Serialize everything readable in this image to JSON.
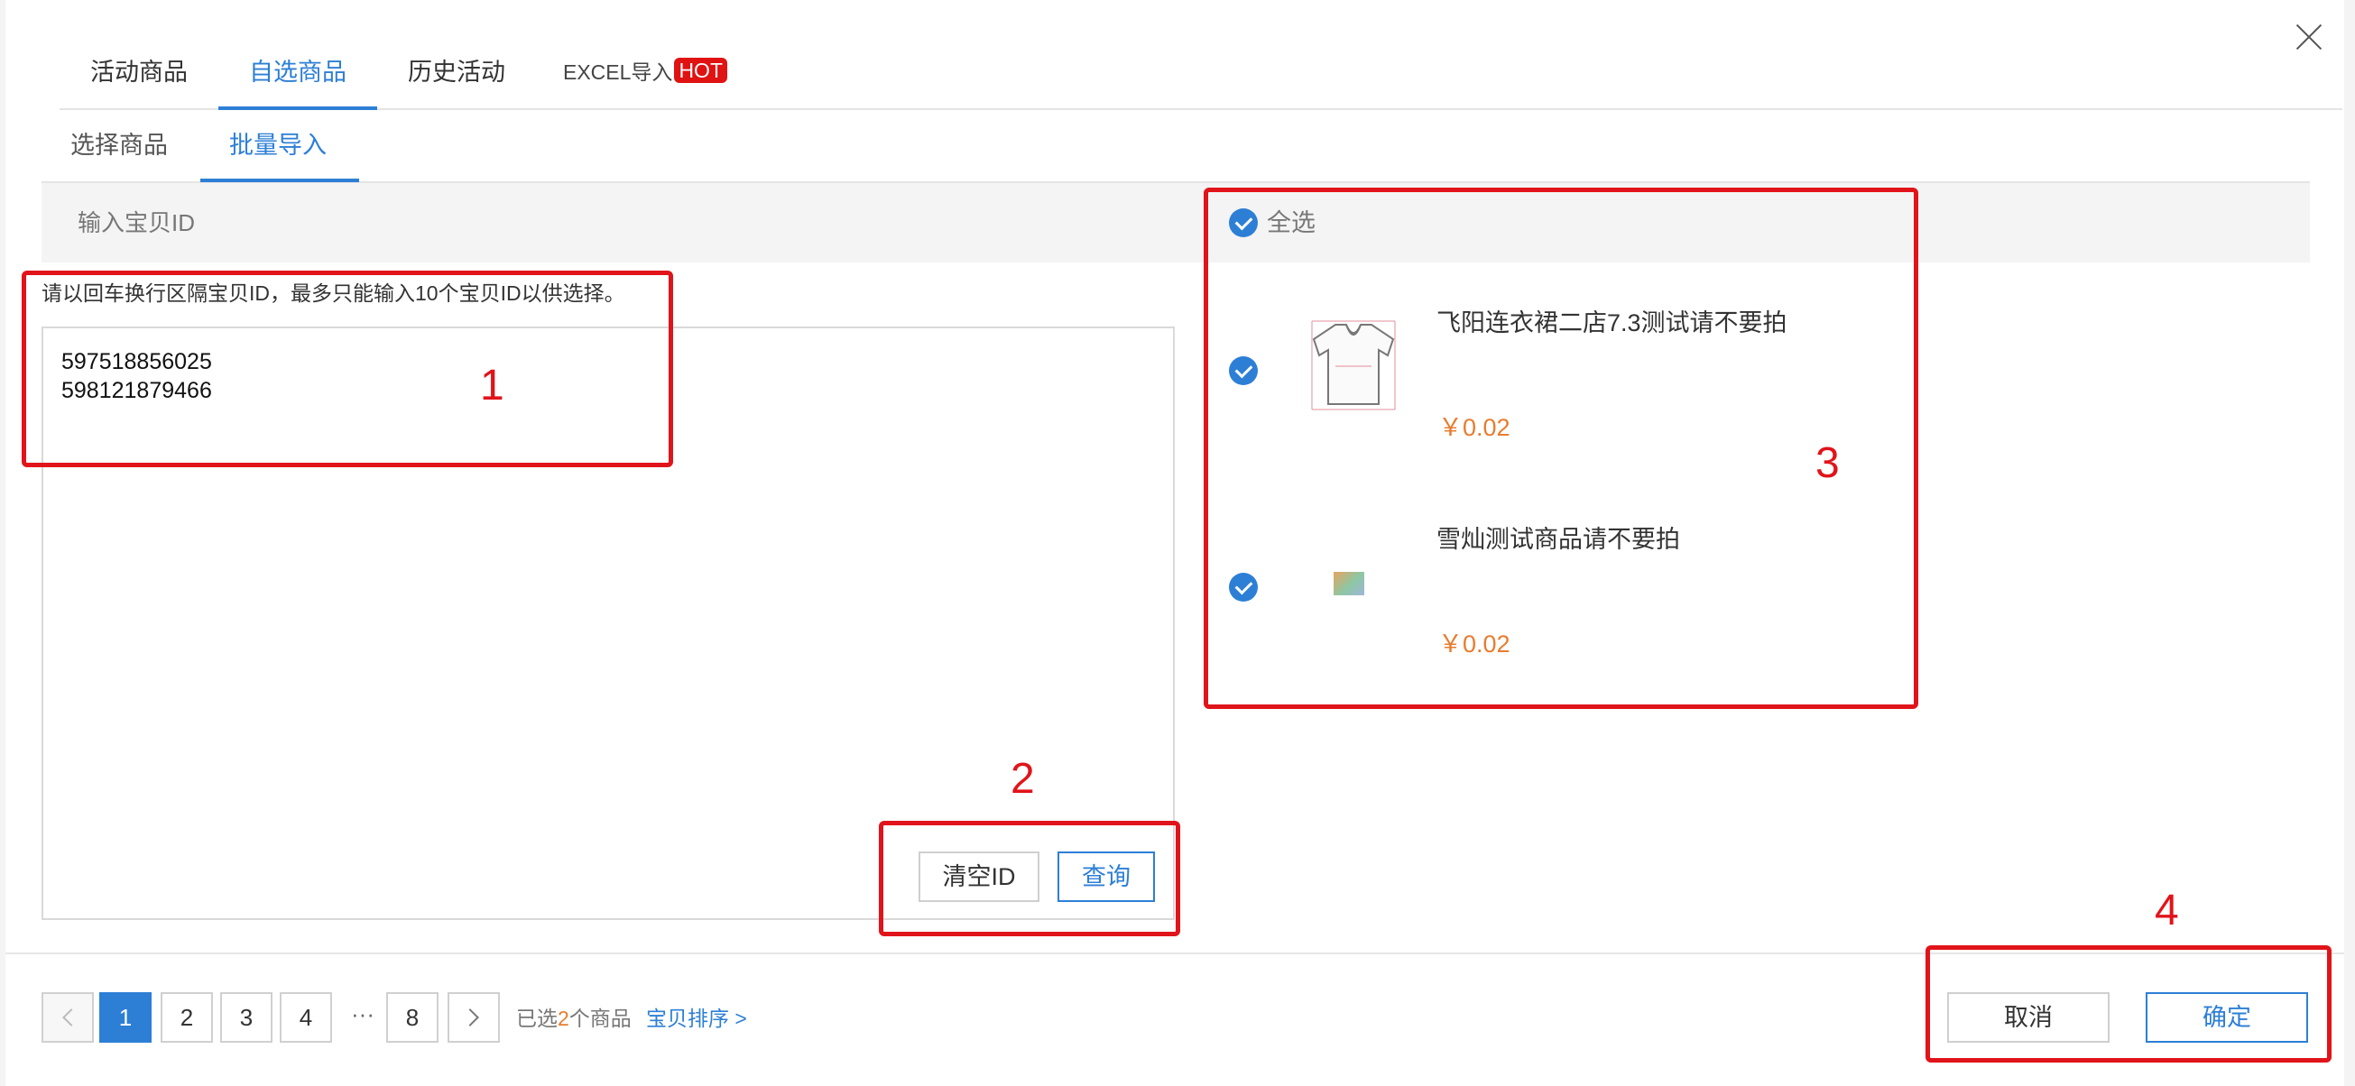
{
  "top_tabs": [
    {
      "label": "活动商品"
    },
    {
      "label": "自选商品"
    },
    {
      "label": "历史活动"
    },
    {
      "label": "EXCEL导入",
      "badge": "HOT"
    }
  ],
  "active_top_tab": "自选商品",
  "sub_tabs": [
    {
      "label": "选择商品"
    },
    {
      "label": "批量导入"
    }
  ],
  "active_sub_tab": "批量导入",
  "left_panel": {
    "header": "输入宝贝ID",
    "hint": "请以回车换行区隔宝贝ID，最多只能输入10个宝贝ID以供选择。",
    "ids": [
      "597518856025",
      "598121879466"
    ],
    "clear_button": "清空ID",
    "query_button": "查询"
  },
  "right_panel": {
    "select_all_label": "全选",
    "products": [
      {
        "title": "飞阳连衣裙二店7.3测试请不要拍",
        "price": "￥0.02",
        "thumb_icon": "tshirt-icon",
        "checked": true
      },
      {
        "title": "雪灿测试商品请不要拍",
        "price": "￥0.02",
        "thumb_icon": "image-thumb-icon",
        "checked": true
      }
    ]
  },
  "footer": {
    "pages": [
      "1",
      "2",
      "3",
      "4",
      "8"
    ],
    "ellipsis": "···",
    "current_page": "1",
    "selected_prefix": "已选",
    "selected_count": "2",
    "selected_suffix": "个商品",
    "sort_link": "宝贝排序 >",
    "cancel_button": "取消",
    "confirm_button": "确定"
  },
  "annotations": [
    "1",
    "2",
    "3",
    "4"
  ],
  "colors": {
    "accent": "#2d7fd6",
    "price": "#e87c2e",
    "annotation": "#e0141a",
    "hot_badge": "#e01212"
  }
}
